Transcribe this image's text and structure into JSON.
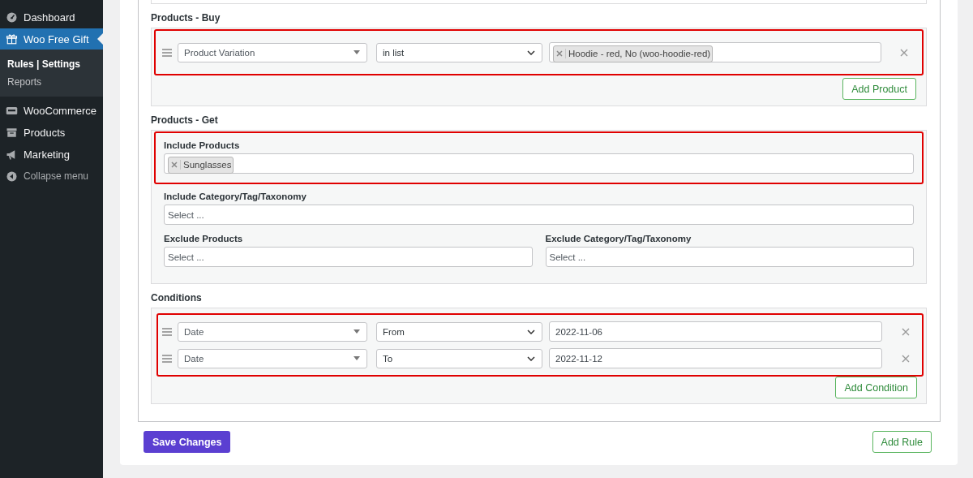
{
  "sidebar": {
    "items": [
      {
        "label": "Dashboard",
        "selected": false
      },
      {
        "label": "Woo Free Gift",
        "selected": true,
        "submenu": [
          {
            "label": "Rules | Settings",
            "selected": true
          },
          {
            "label": "Reports",
            "selected": false
          }
        ]
      },
      {
        "label": "WooCommerce",
        "selected": false
      },
      {
        "label": "Products",
        "selected": false
      },
      {
        "label": "Marketing",
        "selected": false
      }
    ],
    "collapse": "Collapse menu"
  },
  "products_buy": {
    "title": "Products - Buy",
    "highlighted": true,
    "rows": [
      {
        "type": "Product Variation",
        "operator": "in list",
        "tags": [
          "Hoodie - red, No (woo-hoodie-red)"
        ]
      }
    ],
    "add_button": "Add Product"
  },
  "products_get": {
    "title": "Products - Get",
    "include_products": {
      "label": "Include Products",
      "highlighted": true,
      "tags": [
        "Sunglasses"
      ]
    },
    "include_taxonomy": {
      "label": "Include Category/Tag/Taxonomy",
      "placeholder": "Select ..."
    },
    "exclude_products": {
      "label": "Exclude Products",
      "placeholder": "Select ..."
    },
    "exclude_taxonomy": {
      "label": "Exclude Category/Tag/Taxonomy",
      "placeholder": "Select ..."
    }
  },
  "conditions": {
    "title": "Conditions",
    "highlighted": true,
    "rows": [
      {
        "type": "Date",
        "operator": "From",
        "value": "2022-11-06"
      },
      {
        "type": "Date",
        "operator": "To",
        "value": "2022-11-12"
      }
    ],
    "add_button": "Add Condition"
  },
  "save_button": "Save Changes",
  "add_rule_button": "Add Rule"
}
